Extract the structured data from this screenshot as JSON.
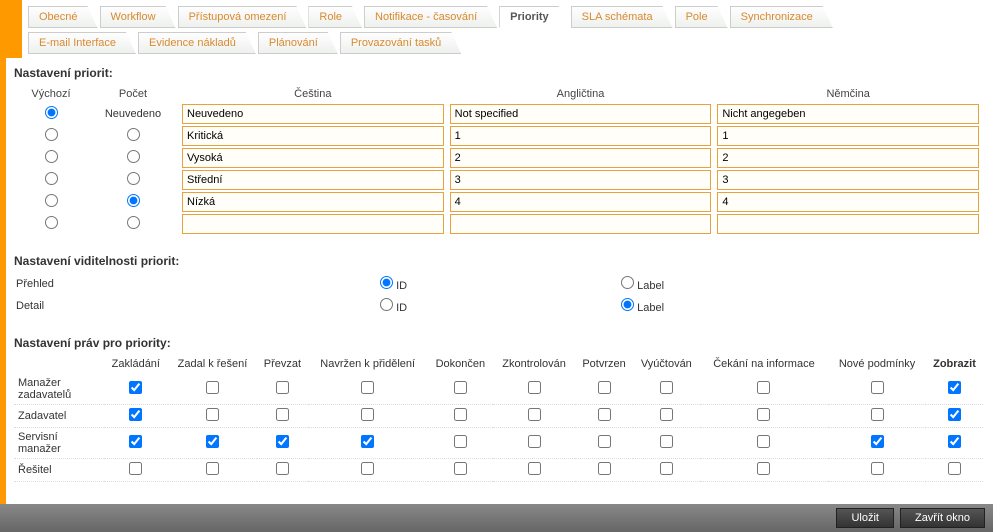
{
  "tabs_row1": [
    {
      "label": "Obecné",
      "active": false
    },
    {
      "label": "Workflow",
      "active": false
    },
    {
      "label": "Přístupová omezení",
      "active": false
    },
    {
      "label": "Role",
      "active": false
    },
    {
      "label": "Notifikace - časování",
      "active": false
    },
    {
      "label": "Priority",
      "active": true
    },
    {
      "label": "SLA schémata",
      "active": false
    },
    {
      "label": "Pole",
      "active": false
    },
    {
      "label": "Synchronizace",
      "active": false
    }
  ],
  "tabs_row2": [
    {
      "label": "E-mail Interface"
    },
    {
      "label": "Evidence nákladů"
    },
    {
      "label": "Plánování"
    },
    {
      "label": "Provazování tasků"
    }
  ],
  "section_priorities": "Nastavení priorit:",
  "headers": {
    "vychozi": "Výchozí",
    "pocet": "Počet",
    "cestina": "Čeština",
    "anglictina": "Angličtina",
    "nemcina": "Němčina"
  },
  "rows": [
    {
      "default": true,
      "count_label": "Neuvedeno",
      "count_radio": null,
      "cs": "Neuvedeno",
      "en": "Not specified",
      "de": "Nicht angegeben"
    },
    {
      "default": false,
      "count_label": null,
      "count_radio": false,
      "cs": "Kritická",
      "en": "1",
      "de": "1"
    },
    {
      "default": false,
      "count_label": null,
      "count_radio": false,
      "cs": "Vysoká",
      "en": "2",
      "de": "2"
    },
    {
      "default": false,
      "count_label": null,
      "count_radio": false,
      "cs": "Střední",
      "en": "3",
      "de": "3"
    },
    {
      "default": false,
      "count_label": null,
      "count_radio": true,
      "cs": "Nízká",
      "en": "4",
      "de": "4"
    },
    {
      "default": false,
      "count_label": null,
      "count_radio": false,
      "cs": "",
      "en": "",
      "de": ""
    }
  ],
  "section_visibility": "Nastavení viditelnosti priorit:",
  "visibility": {
    "row1_label": "Přehled",
    "row2_label": "Detail",
    "opt_id": "ID",
    "opt_label": "Label",
    "prehled": "id",
    "detail": "label"
  },
  "section_rights": "Nastavení práv pro priority:",
  "rights_headers": [
    "Zakládání",
    "Zadal k řešení",
    "Převzat",
    "Navržen k přidělení",
    "Dokončen",
    "Zkontrolován",
    "Potvrzen",
    "Vyúčtován",
    "Čekání na informace",
    "Nové podmínky",
    "Zobrazit"
  ],
  "rights_rows": [
    {
      "role": "Manažer zadavatelů",
      "vals": [
        true,
        false,
        false,
        false,
        false,
        false,
        false,
        false,
        false,
        false,
        true
      ]
    },
    {
      "role": "Zadavatel",
      "vals": [
        true,
        false,
        false,
        false,
        false,
        false,
        false,
        false,
        false,
        false,
        true
      ]
    },
    {
      "role": "Servisní manažer",
      "vals": [
        true,
        true,
        true,
        true,
        false,
        false,
        false,
        false,
        false,
        true,
        true
      ]
    },
    {
      "role": "Řešitel",
      "vals": [
        false,
        false,
        false,
        false,
        false,
        false,
        false,
        false,
        false,
        false,
        false
      ]
    }
  ],
  "buttons": {
    "save": "Uložit",
    "close": "Zavřít okno"
  }
}
